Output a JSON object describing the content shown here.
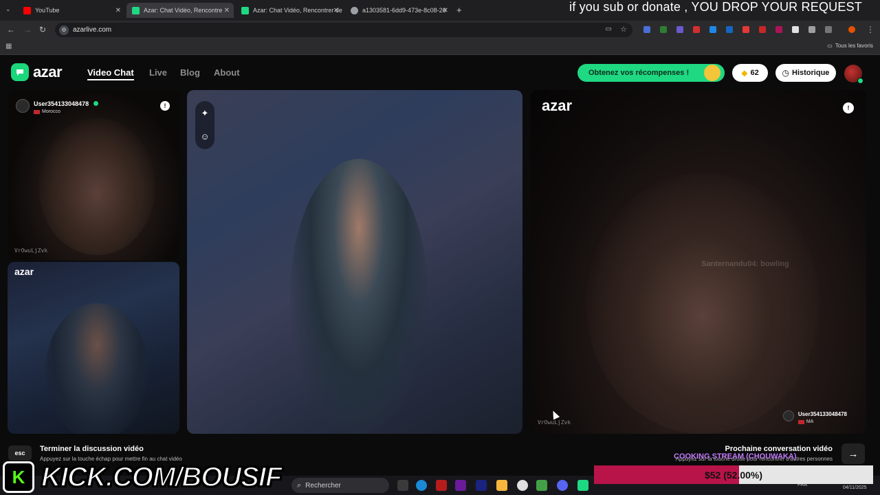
{
  "browser": {
    "tabs": [
      {
        "title": "YouTube",
        "color": "#ff0000"
      },
      {
        "title": "Azar: Chat Vidéo, Rencontre",
        "color": "#1fd882"
      },
      {
        "title": "Azar: Chat Vidéo, Rencontrer de",
        "color": "#1fd882"
      },
      {
        "title": "a1303581-6dd9-473e-8c08-26",
        "color": "#9aa0a6"
      }
    ],
    "new_tab_label": "+",
    "address": "azarlive.com",
    "bookmarks_all_label": "Tous les favoris"
  },
  "stream_banner": "if you sub or donate , YOU DROP YOUR REQUEST",
  "azar": {
    "logo": "azar",
    "nav": [
      "Video Chat",
      "Live",
      "Blog",
      "About"
    ],
    "rewards_label": "Obtenez vos récompenses !",
    "gems_count": "62",
    "history_label": "Historique"
  },
  "remote_user": {
    "name": "User354133048478",
    "country": "Morocco",
    "country_short": "MA",
    "watermark": "VrOwuLjZvk",
    "mirrored_text": "Santernandu04: bowling"
  },
  "panel_logo": "azar",
  "controls": {
    "esc_label": "esc",
    "end_title": "Terminer la discussion vidéo",
    "end_sub": "Appuyez sur la touche échap pour mettre fin au chat vidéo",
    "next_title": "Prochaine conversation vidéo",
    "next_sub": "Appuyez sur la touche droite pour rencontrer d'autres personnes",
    "next_arrow": "→"
  },
  "overlays": {
    "kick_letter": "K",
    "kick_url": "KICK.COM/BOUSIF",
    "cooking": "COOKING STREAM (CHOUWAKA)",
    "goal_text": "$52 (52.00%)",
    "goal_fraction": 0.52,
    "goal_color": "#b8144a"
  },
  "taskbar": {
    "search_label": "Rechercher",
    "lang": "FRA",
    "date": "04/11/2025"
  }
}
